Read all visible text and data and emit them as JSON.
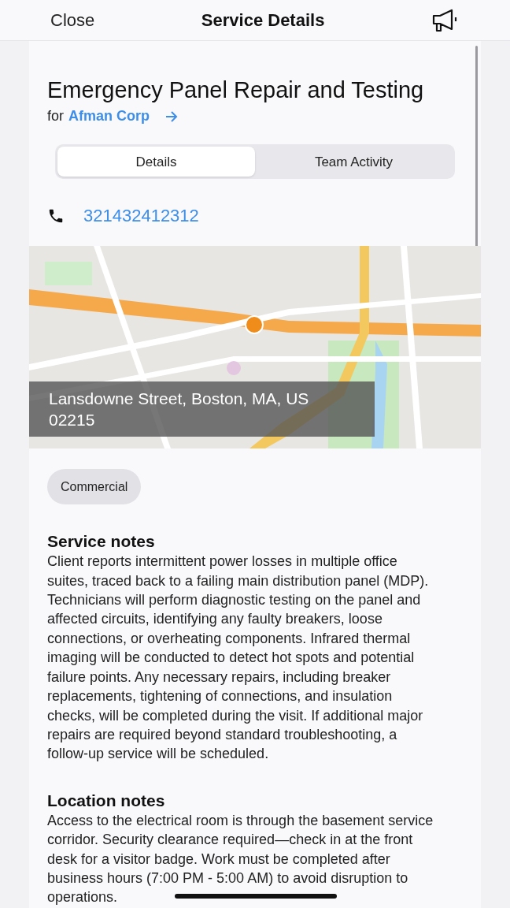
{
  "header": {
    "close": "Close",
    "title": "Service Details"
  },
  "service": {
    "title": "Emergency Panel Repair and Testing",
    "for_label": "for",
    "customer": "Afman Corp"
  },
  "tabs": [
    {
      "label": "Details",
      "selected": true
    },
    {
      "label": "Team Activity",
      "selected": false
    }
  ],
  "phone": "321432412312",
  "map": {
    "kind": "picture",
    "address": "Lansdowne Street, Boston, MA, US 02215"
  },
  "tags": [
    "Commercial"
  ],
  "sections": [
    {
      "heading": "Service notes",
      "text": "Client reports intermittent power losses in multiple office suites, traced back to a failing main distribution panel (MDP). Technicians will perform diagnostic testing on the panel and affected circuits, identifying any faulty breakers, loose connections, or overheating components. Infrared thermal imaging will be conducted to detect hot spots and potential failure points. Any necessary repairs, including breaker replacements, tightening of connections, and insulation checks, will be completed during the visit. If additional major repairs are required beyond standard troubleshooting, a follow-up service will be scheduled."
    },
    {
      "heading": "Location notes",
      "text": "Access to the electrical room is through the basement service corridor. Security clearance required—check in at the front desk for a visitor badge. Work must be completed after business hours (7:00 PM - 5:00 AM) to avoid disruption to operations."
    }
  ]
}
